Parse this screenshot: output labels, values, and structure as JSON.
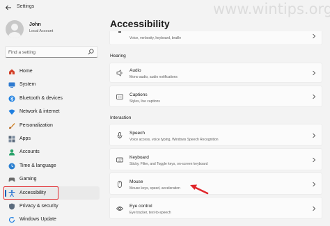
{
  "window": {
    "title": "Settings",
    "watermark": "www.wintips.org"
  },
  "user": {
    "name": "John",
    "account_type": "Local Account"
  },
  "search": {
    "placeholder": "Find a setting"
  },
  "sidebar": {
    "items": [
      {
        "label": "Home",
        "icon": "home-icon",
        "color": "#d2402a"
      },
      {
        "label": "System",
        "icon": "system-icon",
        "color": "#2f7bd0"
      },
      {
        "label": "Bluetooth & devices",
        "icon": "bluetooth-icon",
        "color": "#1f80e0"
      },
      {
        "label": "Network & internet",
        "icon": "network-icon",
        "color": "#1f7fe0"
      },
      {
        "label": "Personalization",
        "icon": "personalization-icon",
        "color": "#d0832a"
      },
      {
        "label": "Apps",
        "icon": "apps-icon",
        "color": "#5b6b7d"
      },
      {
        "label": "Accounts",
        "icon": "accounts-icon",
        "color": "#2aa36b"
      },
      {
        "label": "Time & language",
        "icon": "time-language-icon",
        "color": "#2a7fd0"
      },
      {
        "label": "Gaming",
        "icon": "gaming-icon",
        "color": "#6b6b6b"
      },
      {
        "label": "Accessibility",
        "icon": "accessibility-icon",
        "color": "#1f6fd0",
        "selected": true
      },
      {
        "label": "Privacy & security",
        "icon": "privacy-shield-icon",
        "color": "#5b6b7d"
      },
      {
        "label": "Windows Update",
        "icon": "windows-update-icon",
        "color": "#1f7fe0"
      }
    ]
  },
  "main": {
    "title": "Accessibility",
    "top_card": {
      "subtitle": "Voice, verbosity, keyboard, braille"
    },
    "sections": {
      "hearing": "Hearing",
      "interaction": "Interaction"
    },
    "hearing_items": [
      {
        "title": "Audio",
        "subtitle": "Mono audio, audio notifications",
        "icon": "speaker-icon"
      },
      {
        "title": "Captions",
        "subtitle": "Styles, live captions",
        "icon": "captions-icon"
      }
    ],
    "interaction_items": [
      {
        "title": "Speech",
        "subtitle": "Voice access, voice typing, Windows Speech Recognition",
        "icon": "microphone-icon"
      },
      {
        "title": "Keyboard",
        "subtitle": "Sticky, Filter, and Toggle keys, on-screen keyboard",
        "icon": "keyboard-icon"
      },
      {
        "title": "Mouse",
        "subtitle": "Mouse keys, speed, acceleration",
        "icon": "mouse-icon"
      },
      {
        "title": "Eye control",
        "subtitle": "Eye tracker, text-to-speech",
        "icon": "eye-control-icon"
      }
    ]
  },
  "colors": {
    "accent": "#005fb8",
    "highlight_box": "#e0262b",
    "annotation_arrow": "#e0262b"
  }
}
